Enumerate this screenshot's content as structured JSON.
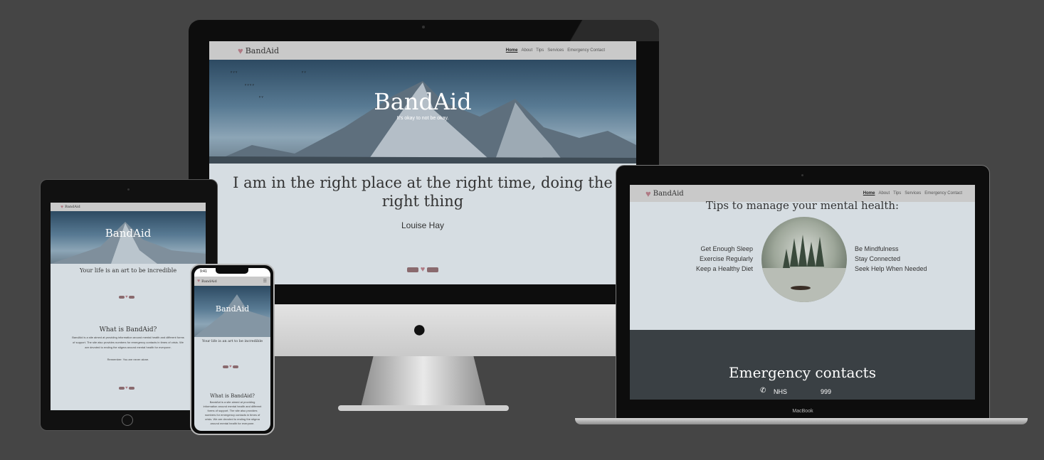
{
  "site": {
    "logo_text": "BandAid",
    "nav": [
      "Home",
      "About",
      "Tips",
      "Services",
      "Emergency Contact"
    ],
    "hero_title": "BandAid",
    "hero_tagline": "It's okay to not be okay.",
    "quote_text": "I am in the right place at the right time, doing the right thing",
    "quote_author": "Louise Hay",
    "tips_heading": "Tips to manage your mental health:",
    "tips_left": [
      "Get Enough Sleep",
      "Exercise Regularly",
      "Keep a Healthy Diet"
    ],
    "tips_right": [
      "Be Mindfulness",
      "Stay Connected",
      "Seek Help When Needed"
    ],
    "emergency_heading": "Emergency contacts",
    "emergency_service": "NHS",
    "emergency_number": "999",
    "about_heading": "What is BandAid?",
    "about_text": "BandAid is a site aimed at providing information around mental health and different forms of support. The site also provides numbers for emergency contacts in times of crisis. We are devoted to ending the stigma around mental health for everyone.",
    "about_remember": "Remember: You are never alone.",
    "tablet_quote": "Your life is an art to be incredible",
    "phone_time": "9:41",
    "phone_quote": "Your life is an art to be incredible"
  },
  "laptop_label": "MacBook",
  "colors": {
    "background": "#454545",
    "screen": "#d6dde2",
    "nav": "#c9c9c9",
    "dark_section": "#3a4044",
    "accent": "#b07a84"
  }
}
